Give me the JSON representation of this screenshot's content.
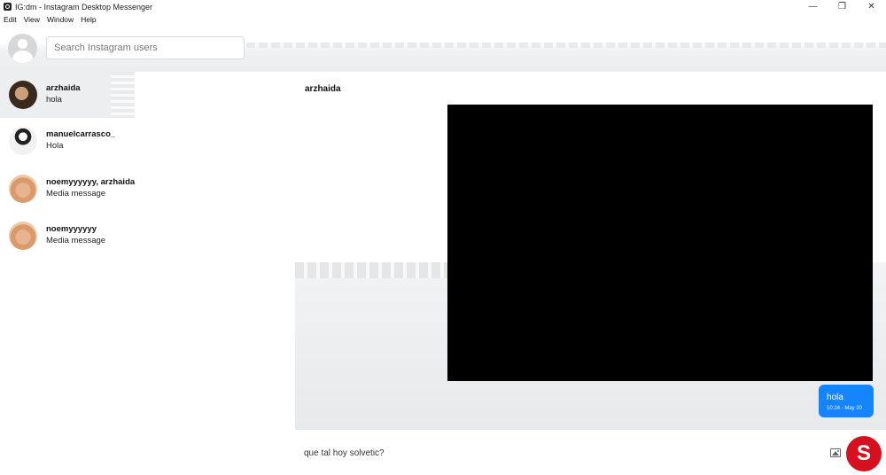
{
  "window": {
    "title": "IG:dm - Instagram Desktop Messenger",
    "controls": {
      "minimize": "—",
      "restore": "❐",
      "close": "✕"
    }
  },
  "menu": [
    "Edit",
    "View",
    "Window",
    "Help"
  ],
  "search": {
    "placeholder": "Search Instagram users",
    "value": ""
  },
  "threads": [
    {
      "name": "arzhaida",
      "last_message": "hola",
      "active": true,
      "avatar": "arzhaida-avatar"
    },
    {
      "name": "manuelcarrasco_",
      "last_message": "Hola",
      "active": false,
      "avatar": "manuelcarrasco-avatar"
    },
    {
      "name": "noemyyyyyy, arzhaida",
      "last_message": "Media message",
      "active": false,
      "avatar": "noemyyyyyy-avatar"
    },
    {
      "name": "noemyyyyyy",
      "last_message": "Media message",
      "active": false,
      "avatar": "noemyyyyyy-avatar"
    }
  ],
  "chat": {
    "title": "arzhaida",
    "messages": [
      {
        "type": "media",
        "from": "other"
      },
      {
        "type": "text",
        "from": "me",
        "text": "hola",
        "time": "10:24 - May 20"
      }
    ]
  },
  "composer": {
    "value": "que tal hoy solvetic?",
    "icons": [
      "image-icon",
      "emoji-icon"
    ]
  },
  "watermark": {
    "letter": "S"
  },
  "colors": {
    "bubble": "#1585ff",
    "active_thread": "#eceef0",
    "media": "#000000"
  }
}
